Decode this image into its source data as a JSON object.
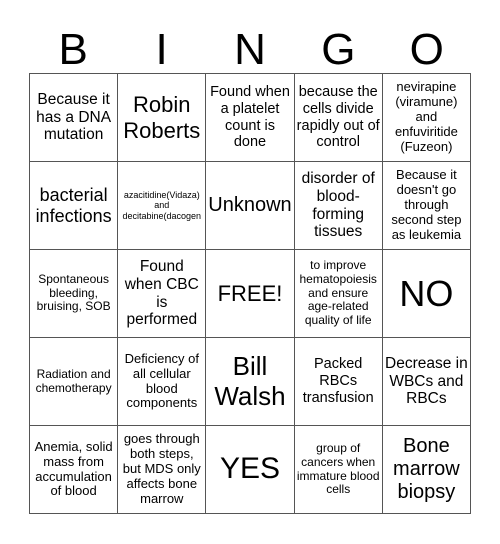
{
  "header": {
    "letters": [
      "B",
      "I",
      "N",
      "G",
      "O"
    ]
  },
  "cells": [
    [
      "Because it has a DNA mutation",
      "Robin Roberts",
      "Found when a platelet count is done",
      "because the cells divide rapidly out of control",
      "nevirapine (viramune) and enfuviritide (Fuzeon)"
    ],
    [
      "bacterial infections",
      "azacitidine(Vidaza) and decitabine(dacogen",
      "Unknown",
      "disorder of blood-forming tissues",
      "Because it doesn't go through second step as leukemia"
    ],
    [
      "Spontaneous bleeding, bruising, SOB",
      "Found when CBC is performed",
      "FREE!",
      "to improve hematopoiesis and ensure age-related quality of life",
      "NO"
    ],
    [
      "Radiation and chemotherapy",
      "Deficiency of all cellular blood components",
      "Bill Walsh",
      "Packed RBCs transfusion",
      "Decrease in WBCs and RBCs"
    ],
    [
      "Anemia, solid mass from accumulation of blood",
      "goes through both steps, but MDS only affects bone marrow",
      "YES",
      "group of cancers when immature blood cells",
      "Bone marrow biopsy"
    ]
  ]
}
